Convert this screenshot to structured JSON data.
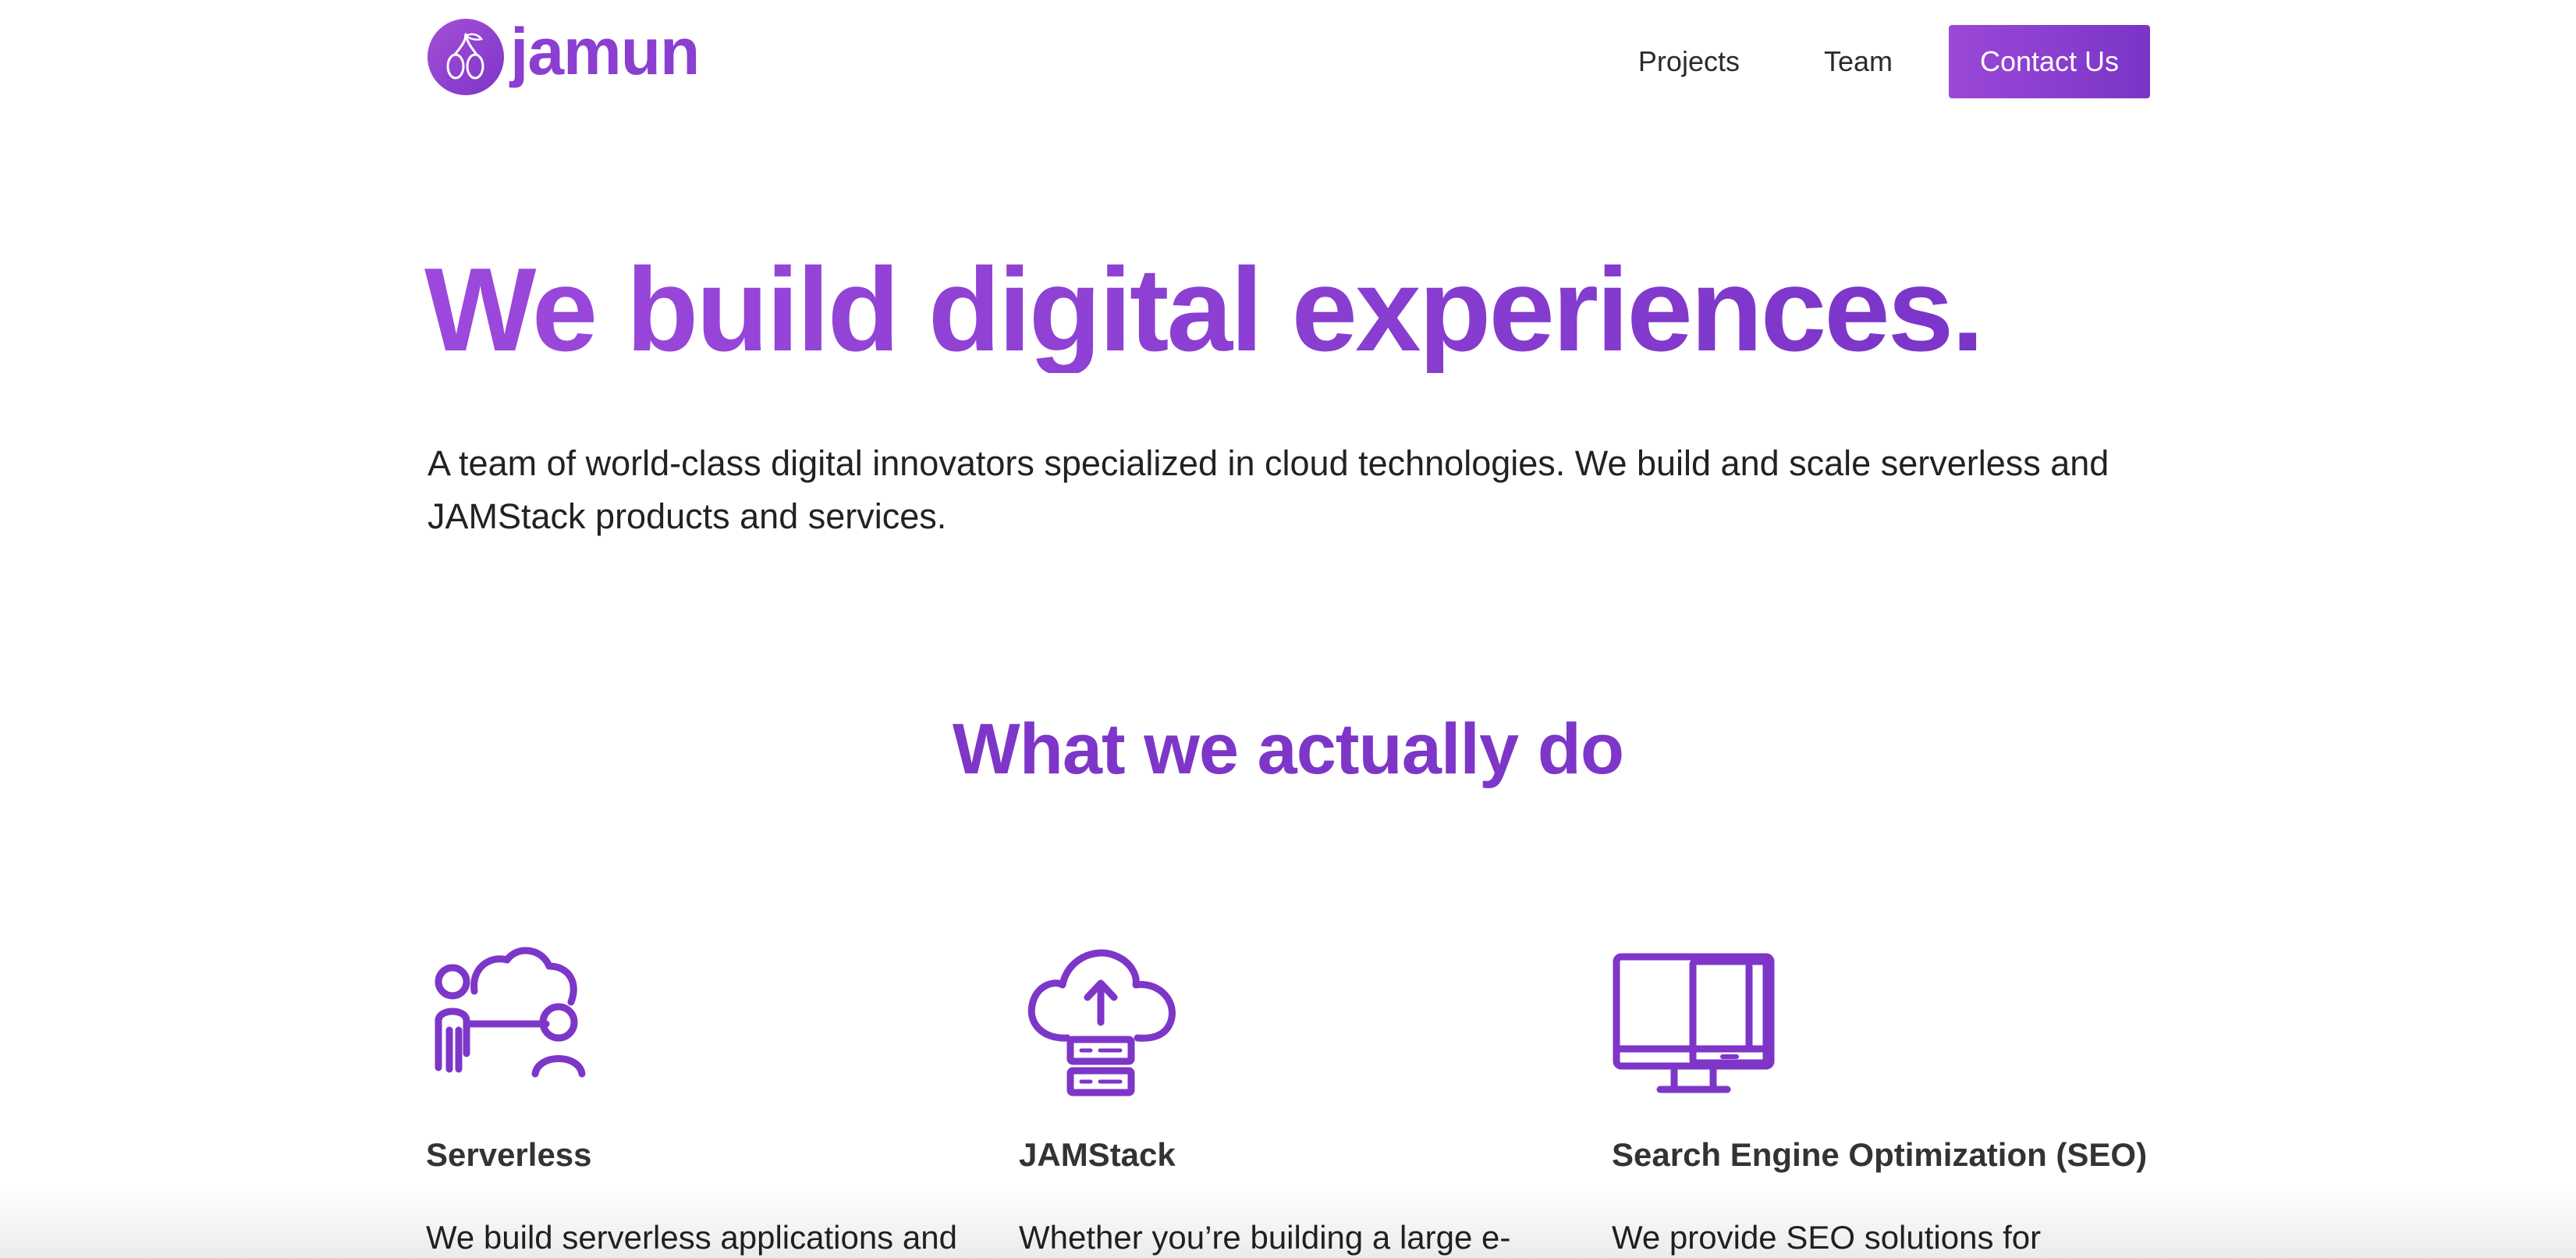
{
  "header": {
    "logo_text": "jamun",
    "nav": [
      {
        "label": "Projects"
      },
      {
        "label": "Team"
      }
    ],
    "contact_label": "Contact Us"
  },
  "hero": {
    "title": "We build digital experiences.",
    "subtitle": "A team of world-class digital innovators specialized in cloud technologies. We build and scale serverless and JAMStack products and services."
  },
  "services": {
    "title": "What we actually do",
    "items": [
      {
        "name": "Serverless",
        "desc": "We build serverless applications and",
        "icon": "cloud-people-icon"
      },
      {
        "name": "JAMStack",
        "desc": "Whether you’re building a large e-",
        "icon": "cloud-upload-server-icon"
      },
      {
        "name": "Search Engine Optimization (SEO)",
        "desc": "We provide SEO solutions for",
        "icon": "monitor-devices-icon"
      }
    ]
  },
  "colors": {
    "brand": "#8a3fd1",
    "brand_dark": "#7d36c8",
    "text": "#2b2b2b"
  }
}
